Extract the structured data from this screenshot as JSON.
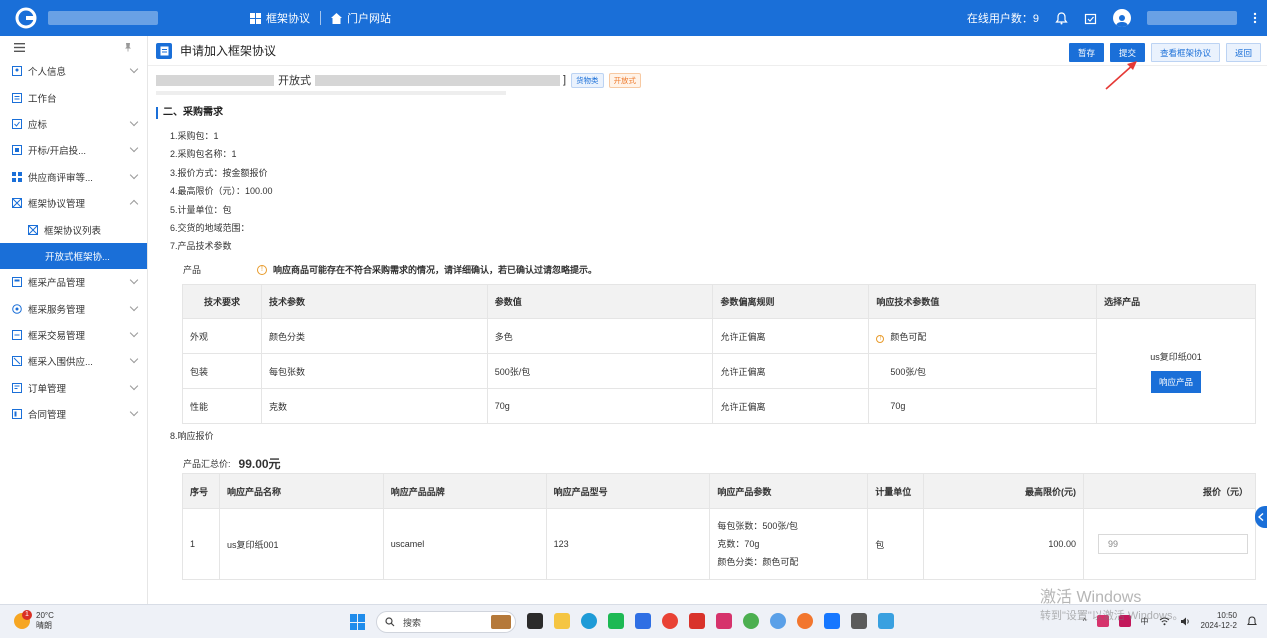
{
  "topbar": {
    "nav": [
      "框架协议",
      "门户网站"
    ],
    "online_label": "在线用户数：",
    "online_count": "9"
  },
  "sidebar": {
    "items": [
      {
        "label": "个人信息",
        "expand": true
      },
      {
        "label": "工作台",
        "expand": false
      },
      {
        "label": "应标",
        "expand": true
      },
      {
        "label": "开标/开启投...",
        "expand": true
      },
      {
        "label": "供应商评审等...",
        "expand": true
      },
      {
        "label": "框架协议管理",
        "expand": true,
        "open": true
      },
      {
        "label": "框架协议列表",
        "sub": true
      },
      {
        "label": "开放式框架协...",
        "active": true
      },
      {
        "label": "框采产品管理",
        "expand": true
      },
      {
        "label": "框采服务管理",
        "expand": true
      },
      {
        "label": "框采交易管理",
        "expand": true
      },
      {
        "label": "框采入围供应...",
        "expand": true
      },
      {
        "label": "订单管理",
        "expand": true
      },
      {
        "label": "合同管理",
        "expand": true
      }
    ]
  },
  "page": {
    "title": "申请加入框架协议",
    "buttons": {
      "save": "暂存",
      "submit": "提交",
      "view": "查看框架协议",
      "back": "返回"
    },
    "subtitle": "开放式",
    "tags": [
      "货物类",
      "开放式"
    ]
  },
  "requirements": {
    "section_title": "二、采购需求",
    "lines": [
      "1.采购包：1",
      "2.采购包名称：1",
      "3.报价方式：按金额报价",
      "4.最高限价（元）：100.00",
      "5.计量单位：包",
      "6.交货的地域范围：",
      "7.产品技术参数"
    ],
    "product_label": "产品",
    "notice": "响应商品可能存在不符合采购需求的情况，请详细确认，若已确认过请忽略提示。"
  },
  "tech_table": {
    "headers": [
      "技术要求",
      "技术参数",
      "参数值",
      "参数偏离规则",
      "响应技术参数值",
      "选择产品"
    ],
    "rows": [
      [
        "外观",
        "颜色分类",
        "多色",
        "允许正偏离",
        "颜色可配"
      ],
      [
        "包装",
        "每包张数",
        "500张/包",
        "允许正偏离",
        "500张/包"
      ],
      [
        "性能",
        "克数",
        "70g",
        "允许正偏离",
        "70g"
      ]
    ],
    "selected_product": "us复印纸001",
    "respond_button": "响应产品"
  },
  "quote": {
    "section": "8.响应报价",
    "total_label": "产品汇总价:",
    "total_value": "99.00元",
    "headers": [
      "序号",
      "响应产品名称",
      "响应产品品牌",
      "响应产品型号",
      "响应产品参数",
      "计量单位",
      "最高限价(元)",
      "报价（元）"
    ],
    "row": {
      "no": "1",
      "name": "us复印纸001",
      "brand": "uscamel",
      "model": "123",
      "params": [
        "每包张数：500张/包",
        "克数：70g",
        "颜色分类：颜色可配"
      ],
      "unit": "包",
      "max_price": "100.00",
      "price": "99"
    }
  },
  "taskbar": {
    "temp": "20°C",
    "weather": "晴朗",
    "badge": "1",
    "search": "搜索",
    "ime": "中",
    "time": "10:50",
    "date": "2024-12-2"
  },
  "watermark": {
    "line1": "激活 Windows",
    "line2": "转到\"设置\"以激活 Windows。"
  },
  "colors": {
    "primary": "#1a6fd8",
    "orange": "#ee7a2c"
  }
}
